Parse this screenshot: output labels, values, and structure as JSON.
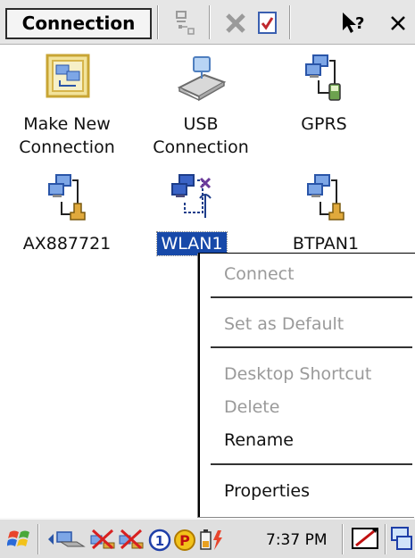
{
  "window": {
    "title": "Connection"
  },
  "toolbar": {
    "icons": [
      "properties-view-icon",
      "delete-icon",
      "ok-check-icon",
      "help-icon",
      "close-icon"
    ]
  },
  "connections": [
    {
      "label_line1": "Make New",
      "label_line2": "Connection",
      "icon": "make-new-connection-icon"
    },
    {
      "label_line1": "USB",
      "label_line2": "Connection",
      "icon": "usb-connection-icon"
    },
    {
      "label_line1": "GPRS",
      "label_line2": "",
      "icon": "gprs-connection-icon"
    },
    {
      "label_line1": "AX887721",
      "label_line2": "",
      "icon": "network-connection-icon"
    },
    {
      "label_line1": "WLAN1",
      "label_line2": "",
      "icon": "wlan-connection-icon",
      "selected": true
    },
    {
      "label_line1": "BTPAN1",
      "label_line2": "",
      "icon": "network-connection-icon"
    }
  ],
  "context_menu": {
    "items": [
      {
        "label": "Connect",
        "enabled": false
      },
      {
        "label": "Set as Default",
        "enabled": false
      },
      {
        "label": "Desktop Shortcut",
        "enabled": false
      },
      {
        "label": "Delete",
        "enabled": false
      },
      {
        "label": "Rename",
        "enabled": true
      },
      {
        "label": "Properties",
        "enabled": true
      }
    ]
  },
  "taskbar": {
    "clock": "7:37 PM",
    "icons": [
      "start-flag-icon",
      "connectivity-icon",
      "network-disconnected-icon",
      "network-disconnected-icon",
      "info-1-icon",
      "p-badge-icon",
      "battery-icon",
      "input-panel-icon",
      "desktop-icon"
    ]
  },
  "colors": {
    "selection": "#1749a9",
    "disabled_text": "#9a9a9a",
    "chrome": "#e6e6e6"
  }
}
